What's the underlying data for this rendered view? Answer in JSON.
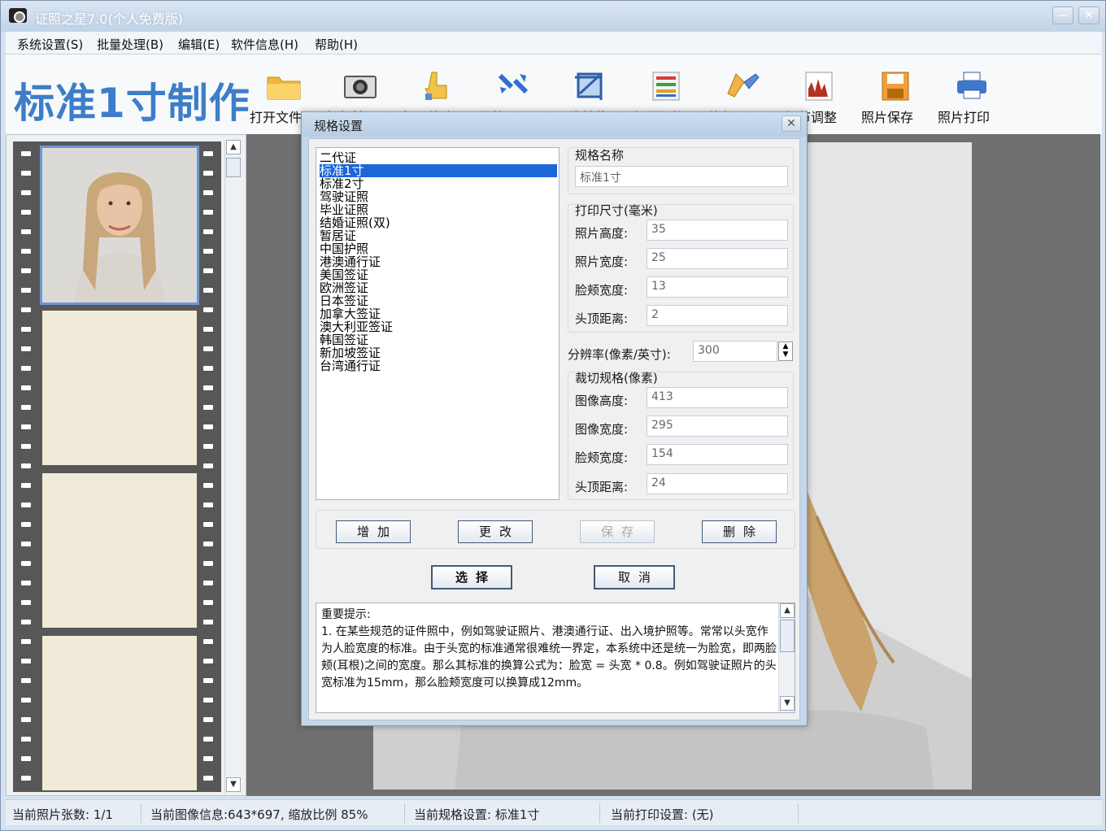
{
  "window": {
    "title": "证照之星7.0(个人免费版)",
    "min_glyph": "—",
    "close_glyph": "✕"
  },
  "menu": {
    "items": [
      "系统设置(S)",
      "批量处理(B)",
      "编辑(E)",
      "软件信息(H)",
      "帮助(H)"
    ]
  },
  "toolbar": {
    "heading": "标准1寸制作",
    "buttons": [
      {
        "label": "打开文件",
        "icon": "folder-icon"
      },
      {
        "label": "相机拍照",
        "icon": "camera-icon"
      },
      {
        "label": "抠图换底",
        "icon": "hand-pointer-icon"
      },
      {
        "label": "规格设置",
        "icon": "arrows-icon"
      },
      {
        "label": "照片剪裁",
        "icon": "crop-icon"
      },
      {
        "label": "色彩调整",
        "icon": "color-bars-icon"
      },
      {
        "label": "修复工具",
        "icon": "brush-icon"
      },
      {
        "label": "细节调整",
        "icon": "histogram-icon"
      },
      {
        "label": "照片保存",
        "icon": "save-icon"
      },
      {
        "label": "照片打印",
        "icon": "printer-icon"
      }
    ]
  },
  "dialog": {
    "title": "规格设置",
    "close_glyph": "✕",
    "spec_list": [
      "二代证",
      "标准1寸",
      "标准2寸",
      "驾驶证照",
      "毕业证照",
      "结婚证照(双)",
      "暂居证",
      "中国护照",
      "港澳通行证",
      "美国签证",
      "欧洲签证",
      "日本签证",
      "加拿大签证",
      "澳大利亚签证",
      "韩国签证",
      "新加坡签证",
      "台湾通行证"
    ],
    "selected_index": 1,
    "spec_name_label": "规格名称",
    "spec_name_value": "标准1寸",
    "print_size_label": "打印尺寸(毫米)",
    "print_fields": [
      {
        "label": "照片高度:",
        "value": "35"
      },
      {
        "label": "照片宽度:",
        "value": "25"
      },
      {
        "label": "脸颊宽度:",
        "value": "13"
      },
      {
        "label": "头顶距离:",
        "value": "2"
      }
    ],
    "resolution_label": "分辨率(像素/英寸):",
    "resolution_value": "300",
    "crop_label": "裁切规格(像素)",
    "crop_fields": [
      {
        "label": "图像高度:",
        "value": "413"
      },
      {
        "label": "图像宽度:",
        "value": "295"
      },
      {
        "label": "脸颊宽度:",
        "value": "154"
      },
      {
        "label": "头顶距离:",
        "value": "24"
      }
    ],
    "buttons": {
      "add": "增加",
      "modify": "更改",
      "save": "保存",
      "delete": "删除",
      "select": "选择",
      "cancel": "取消"
    },
    "notes_title": "重要提示:",
    "notes_body": "1. 在某些规范的证件照中，例如驾驶证照片、港澳通行证、出入境护照等。常常以头宽作为人脸宽度的标准。由于头宽的标准通常很难统一界定，本系统中还是统一为脸宽，即两脸颊(耳根)之间的宽度。那么其标准的换算公式为：脸宽 = 头宽 * 0.8。例如驾驶证照片的头宽标准为15mm，那么脸颊宽度可以换算成12mm。"
  },
  "statusbar": {
    "photo_count": "当前照片张数: 1/1",
    "image_info": "当前图像信息:643*697, 缩放比例 85%",
    "spec": "当前规格设置: 标准1寸",
    "print": "当前打印设置: (无)"
  }
}
